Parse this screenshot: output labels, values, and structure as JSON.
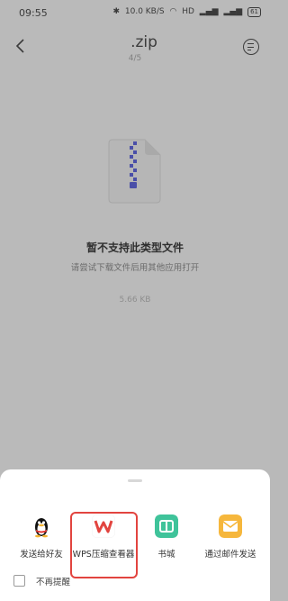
{
  "status_bar": {
    "time": "09:55",
    "speed": "10.0 KB/S",
    "hd": "HD",
    "battery": "61"
  },
  "header": {
    "title": ".zip",
    "page_indicator": "4/5"
  },
  "viewer": {
    "message": "暂不支持此类型文件",
    "hint": "请尝试下载文件后用其他应用打开",
    "size": "5.66 KB"
  },
  "sheet": {
    "apps": [
      {
        "label": "发送给好友",
        "icon": "qq-penguin-icon"
      },
      {
        "label": "WPS压缩查看器",
        "icon": "wps-icon"
      },
      {
        "label": "书城",
        "icon": "book-city-icon"
      },
      {
        "label": "通过邮件发送",
        "icon": "mail-icon"
      }
    ],
    "dont_remind_label": "不再提醒"
  },
  "colors": {
    "wps_red": "#e2443f",
    "book_green": "#3fc39a",
    "mail_yellow": "#f6b73c",
    "highlight": "#e2443f"
  }
}
